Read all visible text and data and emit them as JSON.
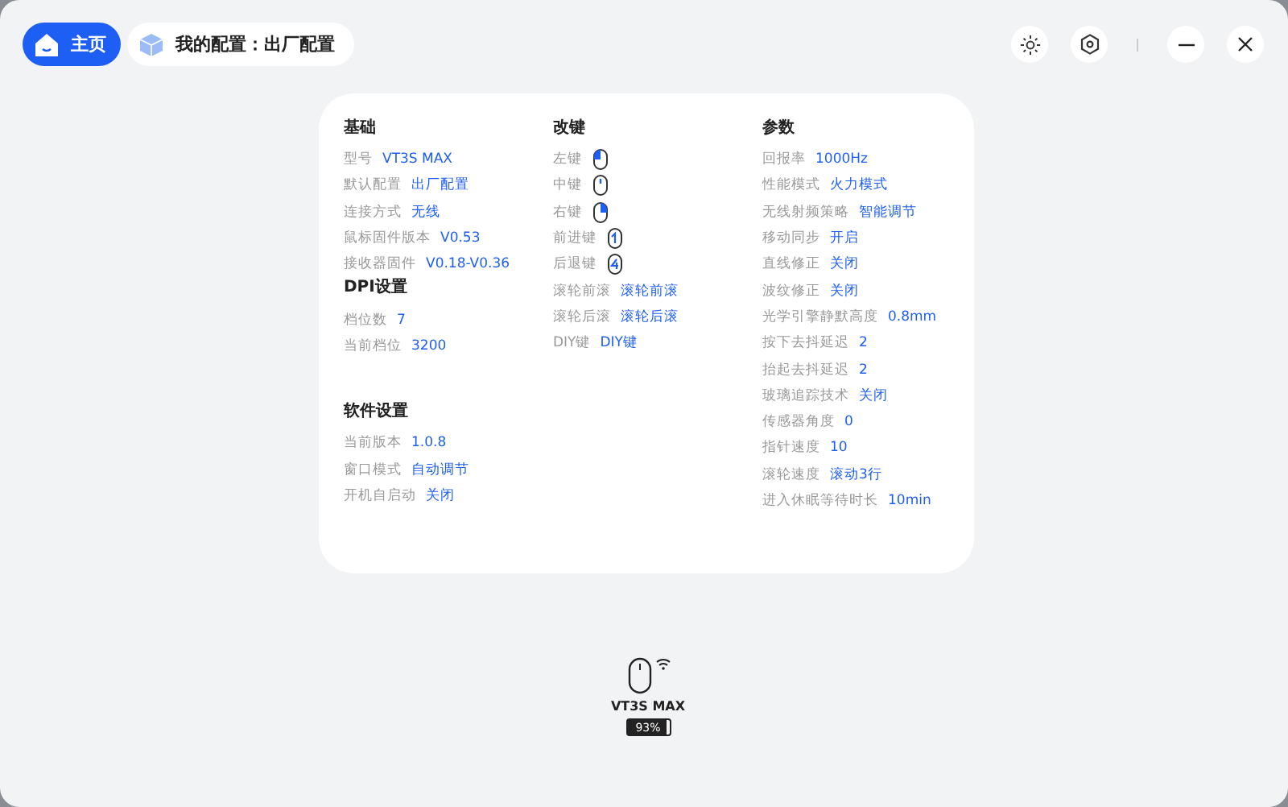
{
  "tabs": [
    {
      "label": "主页",
      "kind": "home",
      "selected": true
    },
    {
      "label": "我的配置：出厂配置",
      "kind": "config",
      "selected": false
    }
  ],
  "columns": [
    {
      "sections": [
        {
          "title": "基础",
          "rows": [
            {
              "label": "型号",
              "value": "VT3S MAX"
            },
            {
              "label": "默认配置",
              "value": "出厂配置"
            },
            {
              "label": "连接方式",
              "value": "无线"
            },
            {
              "label": "鼠标固件版本",
              "value": "V0.53"
            },
            {
              "label": "接收器固件",
              "value": "V0.18-V0.36"
            }
          ]
        },
        {
          "title": "DPI设置",
          "rows": [
            {
              "label": "档位数",
              "value": "7"
            },
            {
              "label": "当前档位",
              "value": "3200"
            }
          ]
        },
        {
          "title": "软件设置",
          "rows": [
            {
              "label": "当前版本",
              "value": "1.0.8"
            },
            {
              "label": "窗口模式",
              "value": "自动调节"
            },
            {
              "label": "开机自启动",
              "value": "关闭"
            }
          ]
        }
      ]
    },
    {
      "sections": [
        {
          "title": "改键",
          "rows": [
            {
              "label": "左键",
              "kind": "left"
            },
            {
              "label": "中键",
              "kind": "middle"
            },
            {
              "label": "右键",
              "kind": "right"
            },
            {
              "label": "前进键",
              "kind": "forward"
            },
            {
              "label": "后退键",
              "kind": "back"
            },
            {
              "label": "滚轮前滚",
              "value": "滚轮前滚"
            },
            {
              "label": "滚轮后滚",
              "value": "滚轮后滚"
            },
            {
              "label": "DIY键",
              "value": "DIY键"
            }
          ]
        }
      ]
    },
    {
      "sections": [
        {
          "title": "参数",
          "rows": [
            {
              "label": "回报率",
              "value": "1000Hz"
            },
            {
              "label": "性能模式",
              "value": "火力模式"
            },
            {
              "label": "无线射频策略",
              "value": "智能调节"
            },
            {
              "label": "移动同步",
              "value": "开启"
            },
            {
              "label": "直线修正",
              "value": "关闭"
            },
            {
              "label": "波纹修正",
              "value": "关闭"
            },
            {
              "label": "光学引擎静默高度",
              "value": "0.8mm"
            },
            {
              "label": "按下去抖延迟",
              "value": "2"
            },
            {
              "label": "抬起去抖延迟",
              "value": "2"
            },
            {
              "label": "玻璃追踪技术",
              "value": "关闭"
            },
            {
              "label": "传感器角度",
              "value": "0"
            },
            {
              "label": "指针速度",
              "value": "10"
            },
            {
              "label": "滚轮速度",
              "value": "滚动3行"
            },
            {
              "label": "进入休眠等待时长",
              "value": "10min"
            }
          ]
        }
      ]
    }
  ],
  "device": {
    "name": "VT3S MAX",
    "battery": {
      "level": 0.93,
      "reading": "93%"
    }
  }
}
